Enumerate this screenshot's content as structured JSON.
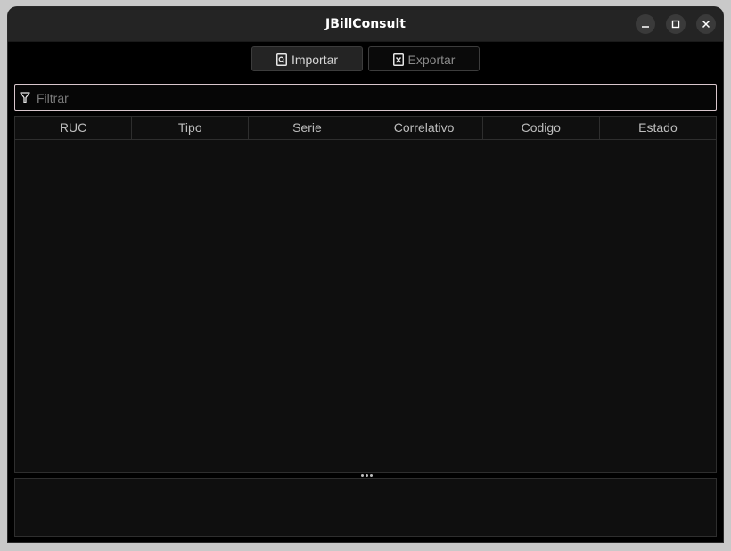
{
  "window": {
    "title": "JBillConsult"
  },
  "toolbar": {
    "import_label": "Importar",
    "import_icon": "document-search-icon",
    "export_label": "Exportar",
    "export_icon": "excel-file-icon"
  },
  "filter": {
    "placeholder": "Filtrar",
    "value": "",
    "icon": "funnel-icon"
  },
  "table": {
    "columns": [
      "RUC",
      "Tipo",
      "Serie",
      "Correlativo",
      "Codigo",
      "Estado"
    ],
    "rows": []
  }
}
